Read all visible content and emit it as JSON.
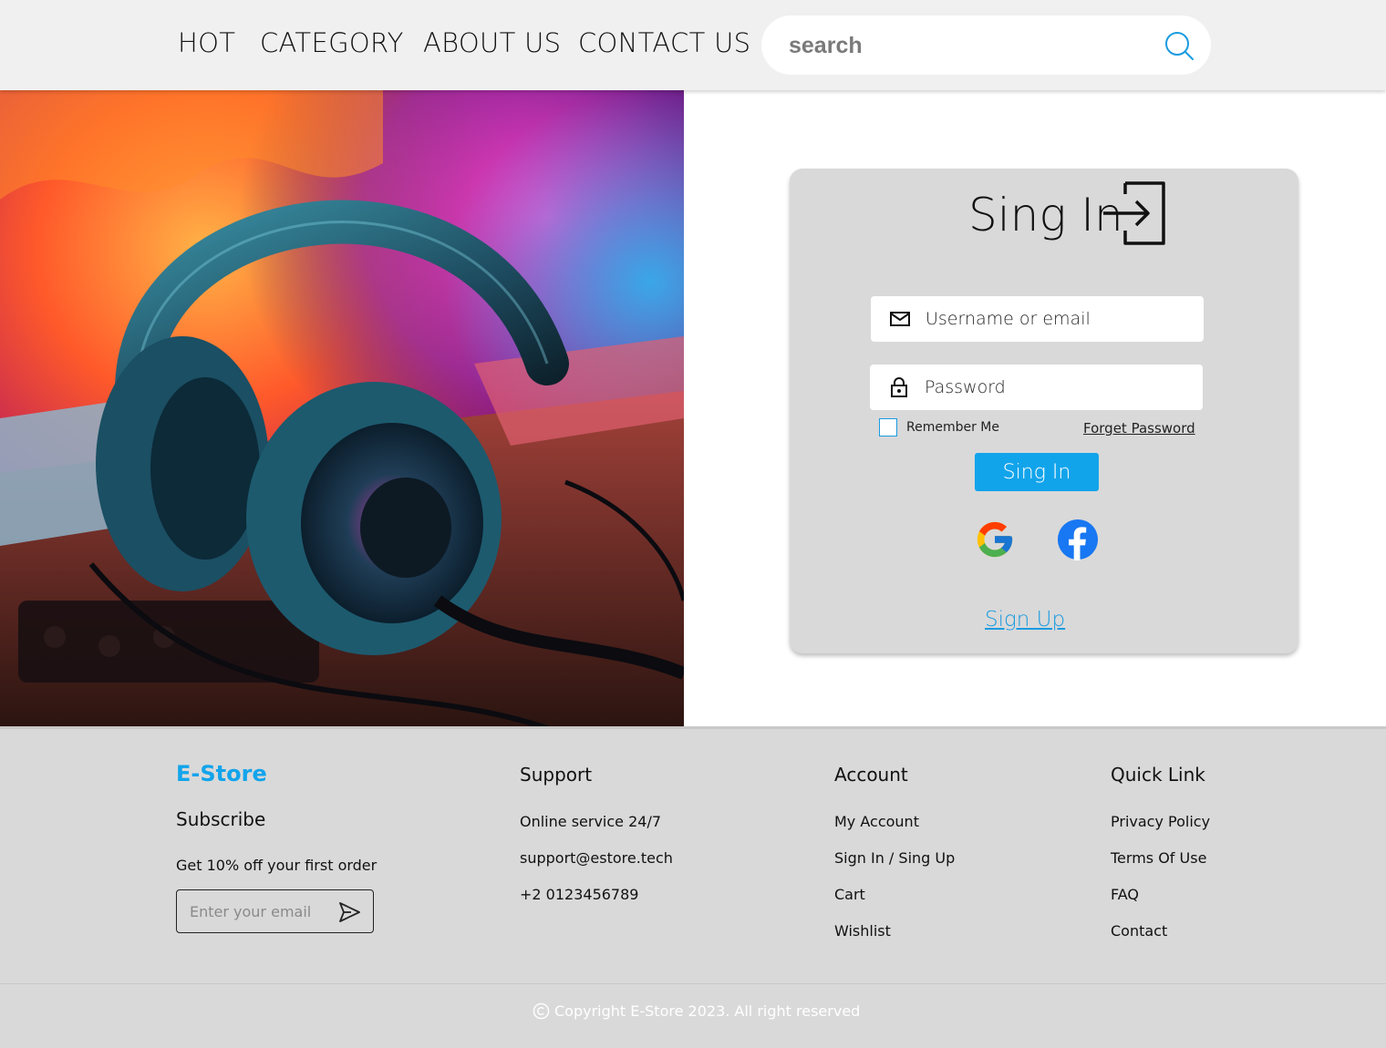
{
  "nav": {
    "items": [
      {
        "label": "HOT"
      },
      {
        "label": "CATEGORY"
      },
      {
        "label": "ABOUT US"
      },
      {
        "label": "CONTACT US"
      }
    ],
    "search_placeholder": "search"
  },
  "hero": {
    "icon": "headphones-image"
  },
  "signin": {
    "title": "Sing In",
    "title_icon": "login-icon",
    "username_placeholder": "Username or email",
    "password_placeholder": "Password",
    "remember_label": "Remember Me",
    "forgot_label": "Forget Password",
    "button_label": "Sing In",
    "signup_label": "Sign Up",
    "social": [
      "google-icon",
      "facebook-icon"
    ]
  },
  "footer": {
    "brand": "E-Store",
    "subscribe_heading": "Subscribe",
    "subscribe_text": "Get 10% off your first order",
    "email_placeholder": "Enter your email",
    "columns": [
      {
        "heading": "Support",
        "items": [
          "Online service 24/7",
          "support@estore.tech",
          "+2 0123456789"
        ]
      },
      {
        "heading": "Account",
        "items": [
          "My Account",
          "Sign In / Sing Up",
          "Cart",
          "Wishlist"
        ]
      },
      {
        "heading": "Quick Link",
        "items": [
          "Privacy Policy",
          "Terms Of Use",
          "FAQ",
          "Contact"
        ]
      }
    ],
    "copyright": "Copyright E-Store 2023. All right reserved"
  },
  "colors": {
    "accent": "#12a4eb",
    "header_bg": "#f0f0f0",
    "card_bg": "#d9d9d9",
    "footer_bg": "#d9d9d9"
  }
}
